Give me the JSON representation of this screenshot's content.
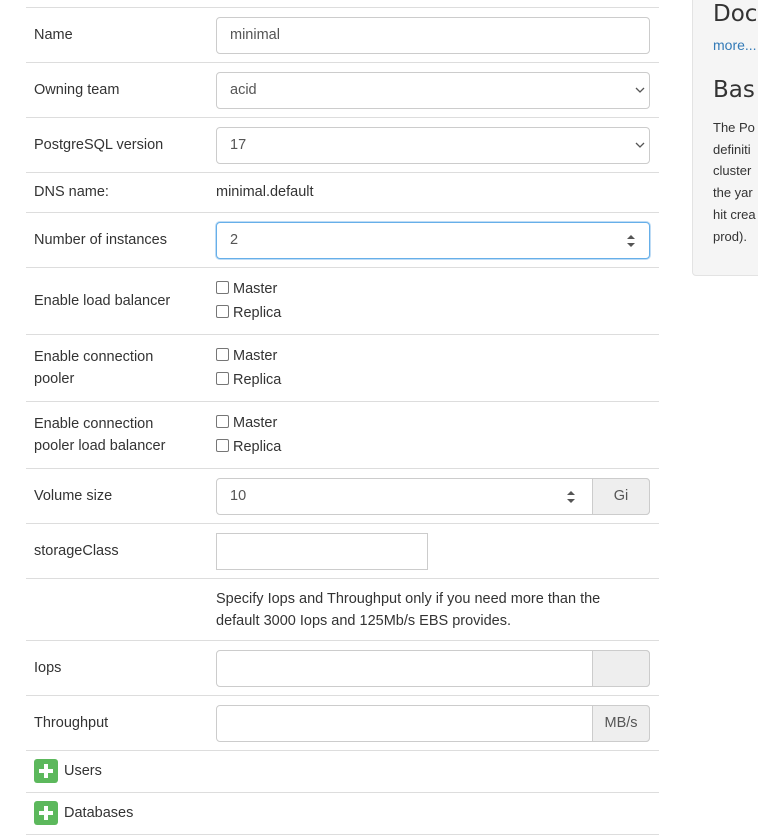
{
  "form": {
    "name": {
      "label": "Name",
      "value": "minimal"
    },
    "team": {
      "label": "Owning team",
      "value": "acid"
    },
    "version": {
      "label": "PostgreSQL version",
      "value": "17"
    },
    "dns": {
      "label": "DNS name:",
      "value": "minimal.default"
    },
    "instances": {
      "label": "Number of instances",
      "value": "2"
    },
    "load_balancer": {
      "label": "Enable load balancer",
      "master": "Master",
      "replica": "Replica"
    },
    "pooler": {
      "label_line1": "Enable connection",
      "label_line2": "pooler",
      "master": "Master",
      "replica": "Replica"
    },
    "pooler_lb": {
      "label_line1": "Enable connection",
      "label_line2": "pooler load balancer",
      "master": "Master",
      "replica": "Replica"
    },
    "volume": {
      "label": "Volume size",
      "value": "10",
      "unit": "Gi"
    },
    "storage_class": {
      "label": "storageClass",
      "value": ""
    },
    "iops_note": {
      "line1": "Specify Iops and Throughput only if you need more than the",
      "line2": "default 3000 Iops and 125Mb/s EBS provides."
    },
    "iops": {
      "label": "Iops",
      "value": "",
      "unit": ""
    },
    "throughput": {
      "label": "Throughput",
      "value": "",
      "unit": "MB/s"
    },
    "users": {
      "label": "Users"
    },
    "databases": {
      "label": "Databases"
    }
  },
  "sidebar": {
    "doc_title": "Doc",
    "more_link": "more...",
    "basics_title": "Bas",
    "basics_text": [
      "The Po",
      "definiti",
      "cluster",
      "the yar",
      "hit crea",
      "prod)."
    ]
  },
  "colors": {
    "add_button": "#5cb85c",
    "link": "#337ab7",
    "focus_border": "#66afe9"
  }
}
